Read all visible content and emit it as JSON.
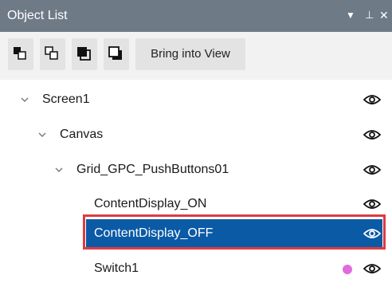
{
  "panel": {
    "title": "Object List",
    "dropdown_glyph": "▼",
    "pin_glyph": "⊥",
    "close_glyph": "✕"
  },
  "toolbar": {
    "buttons": [
      {
        "icon": "bring-forward-icon"
      },
      {
        "icon": "send-backward-icon"
      },
      {
        "icon": "bring-to-front-icon"
      },
      {
        "icon": "send-to-back-icon"
      }
    ],
    "bring_into_view_label": "Bring into View"
  },
  "tree": {
    "items": [
      {
        "label": "Screen1",
        "level": 0,
        "expanded": true
      },
      {
        "label": "Canvas",
        "level": 1,
        "expanded": true
      },
      {
        "label": "Grid_GPC_PushButtons01",
        "level": 2,
        "expanded": true
      },
      {
        "label": "ContentDisplay_ON",
        "level": 3
      },
      {
        "label": "ContentDisplay_OFF",
        "level": 3,
        "selected": true
      },
      {
        "label": "Switch1",
        "level": 3,
        "status_color": "#e06cdc"
      }
    ]
  },
  "colors": {
    "title_bar": "#6f7a87",
    "selection": "#0b5aa6",
    "highlight_outline": "#e03a40",
    "status_dot": "#e06cdc"
  }
}
